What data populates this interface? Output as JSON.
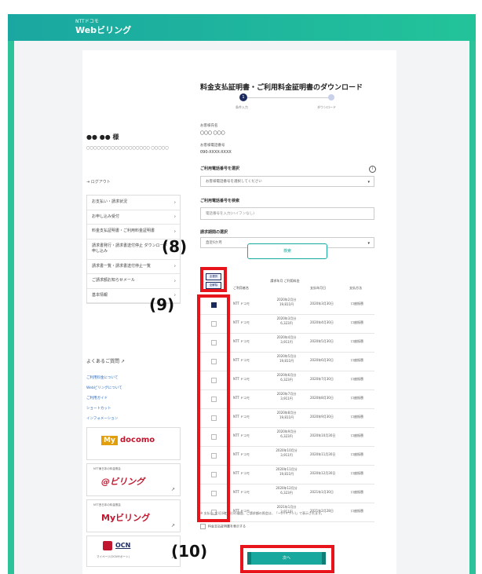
{
  "header": {
    "brand_small": "NTTドコモ",
    "brand_main": "Webビリング"
  },
  "user": {
    "name": "●● ●● 様",
    "address": "〇〇〇〇〇〇〇〇〇〇〇〇〇〇〇〇〇〇 〇〇〇〇〇",
    "logout": "ログアウト"
  },
  "sidebar": {
    "items": [
      {
        "label": "お支払い・請求状況"
      },
      {
        "label": "お申し込み受付"
      },
      {
        "label": "料金支払証明書・ご利用料金証明書"
      },
      {
        "label": "請求書発行・請求書送付停止 ダウンロード申し込み"
      },
      {
        "label": "請求書一覧・請求書送付停止一覧"
      },
      {
        "label": "ご請求額お知らせメール"
      },
      {
        "label": "基本情報"
      }
    ],
    "faq": "よくあるご質問",
    "links": [
      "ご利用料金について",
      "Webビリングについて",
      "ご利用ガイド",
      "ショートカット",
      "インフォメーション"
    ]
  },
  "ads": {
    "docomo": "My docomo",
    "docomo_prefix": "My",
    "docomo_text": "docomo",
    "at_billing_caption": "NTT東日本の料金照会",
    "at_billing": "@ビリング",
    "my_billing_caption": "NTT西日本の料金照会",
    "my_billing": "Myビリング",
    "ocn": "OCN",
    "ocn_caption": "マイページ(OCNサポート)"
  },
  "main": {
    "title": "料金支払証明書・ご利用料金証明書のダウンロード",
    "steps": [
      "条件入力",
      "ダウンロード"
    ],
    "customer_name_label": "お客様氏名",
    "customer_name": "〇〇〇 〇〇〇",
    "customer_number_label": "お客様電話番号",
    "customer_number": "090-XXXX-XXXX",
    "phone_select_label": "ご利用電話番号を選択",
    "phone_select_placeholder": "お客様電話番号を選択してください",
    "phone_input_label": "ご利用電話番号を検索",
    "phone_input_placeholder": "電話番号を入力(ハイフンなし)",
    "period_label": "請求期間の選択",
    "period_value": "直近6か月",
    "info_icon": "i",
    "search_button": "検索",
    "select_all": "全選択",
    "deselect_all": "全解除",
    "columns": [
      "ご利用者名",
      "請求年月 ご利用料金",
      "支払年月日",
      "支払方法"
    ],
    "rows": [
      {
        "checked": true,
        "user": "NTT ドコモ",
        "month": "2020年2月分",
        "amount": "19,811円",
        "date": "2020年3月30日",
        "method": "口座振替"
      },
      {
        "checked": false,
        "user": "NTT ドコモ",
        "month": "2020年3月分",
        "amount": "6,323円",
        "date": "2020年4月30日",
        "method": "口座振替"
      },
      {
        "checked": false,
        "user": "NTT ドコモ",
        "month": "2020年4月分",
        "amount": "3,911円",
        "date": "2020年5月30日",
        "method": "口座振替"
      },
      {
        "checked": false,
        "user": "NTT ドコモ",
        "month": "2020年5月分",
        "amount": "19,811円",
        "date": "2020年6月30日",
        "method": "口座振替"
      },
      {
        "checked": false,
        "user": "NTT ドコモ",
        "month": "2020年6月分",
        "amount": "6,323円",
        "date": "2020年7月30日",
        "method": "口座振替"
      },
      {
        "checked": false,
        "user": "NTT ドコモ",
        "month": "2020年7月分",
        "amount": "3,911円",
        "date": "2020年8月30日",
        "method": "口座振替"
      },
      {
        "checked": false,
        "user": "NTT ドコモ",
        "month": "2020年8月分",
        "amount": "19,811円",
        "date": "2020年9月30日",
        "method": "口座振替"
      },
      {
        "checked": false,
        "user": "NTT ドコモ",
        "month": "2020年9月分",
        "amount": "6,323円",
        "date": "2020年10月30日",
        "method": "口座振替"
      },
      {
        "checked": false,
        "user": "NTT ドコモ",
        "month": "2020年10月分",
        "amount": "3,911円",
        "date": "2020年11月30日",
        "method": "口座振替"
      },
      {
        "checked": false,
        "user": "NTT ドコモ",
        "month": "2020年11月分",
        "amount": "19,811円",
        "date": "2020年12月30日",
        "method": "口座振替"
      },
      {
        "checked": false,
        "user": "NTT ドコモ",
        "month": "2020年12月分",
        "amount": "6,323円",
        "date": "2021年1月30日",
        "method": "口座振替"
      },
      {
        "checked": false,
        "user": "NTT ドコモ",
        "month": "2021年1月分",
        "amount": "3,911円",
        "date": "2021年2月28日",
        "method": "口座振替"
      }
    ],
    "note": "※ 支払(入金)日(確定分)の履歴、ご請求額の照会は、「ー(ハイフン)」で表示されます。",
    "agree": "料金支払証明書を表示する",
    "next_button": "次へ"
  },
  "annotations": {
    "a8": "(8)",
    "a9": "(9)",
    "a10": "(10)",
    "color": "#e8141c"
  }
}
